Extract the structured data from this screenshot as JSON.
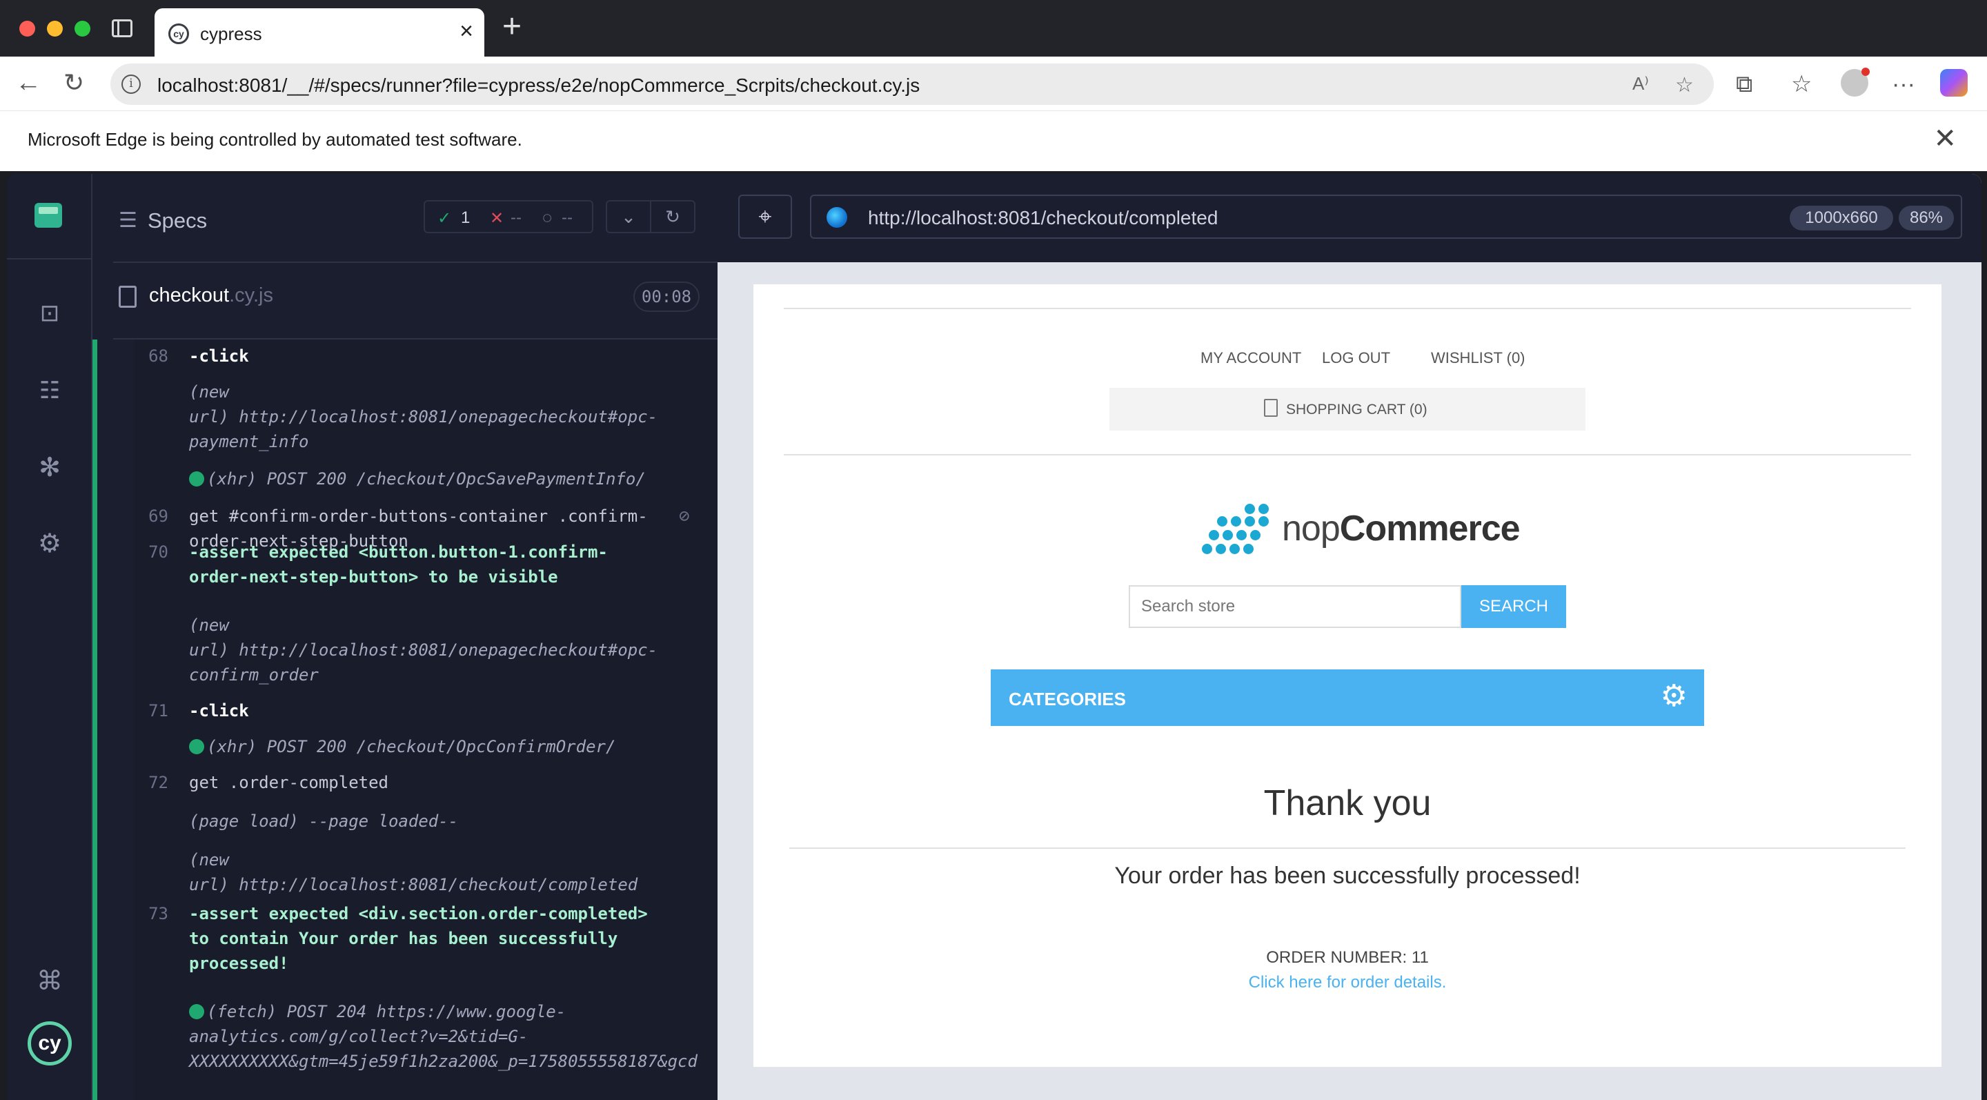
{
  "browser": {
    "tab_title": "cypress",
    "tab_favicon": "cy",
    "address": "localhost:8081/__/#/specs/runner?file=cypress/e2e/nopCommerce_Scrpits/checkout.cy.js",
    "info_bar": "Microsoft Edge is being controlled by automated test software."
  },
  "cypress": {
    "nav_logo_text": "cy",
    "reporter": {
      "specs_label": "Specs",
      "passed": "1",
      "failed": "--",
      "pending": "--",
      "spec_name": "checkout",
      "spec_ext": ".cy.js",
      "duration": "00:08"
    },
    "log": [
      {
        "num": "68",
        "lines": [
          "-click"
        ]
      },
      {
        "num": "",
        "lines": [
          "(new",
          "url)  http://localhost:8081/onepagecheckout#opc-",
          "payment_info"
        ]
      },
      {
        "num": "",
        "lines": [
          "(xhr)  POST 200 /checkout/OpcSavePaymentInfo/"
        ]
      },
      {
        "num": "69",
        "lines": [
          "get  #confirm-order-buttons-container .confirm-",
          "order-next-step-button"
        ]
      },
      {
        "num": "70",
        "lines": [
          "-assert  expected  <button.button-1.confirm-",
          "order-next-step-button>  to be  visible"
        ]
      },
      {
        "num": "",
        "lines": [
          "(new",
          "url)  http://localhost:8081/onepagecheckout#opc-",
          "confirm_order"
        ]
      },
      {
        "num": "71",
        "lines": [
          "-click"
        ]
      },
      {
        "num": "",
        "lines": [
          "(xhr)  POST 200 /checkout/OpcConfirmOrder/"
        ]
      },
      {
        "num": "72",
        "lines": [
          "get  .order-completed"
        ]
      },
      {
        "num": "",
        "lines": [
          "(page load)  --page loaded--"
        ]
      },
      {
        "num": "",
        "lines": [
          "(new",
          "url)  http://localhost:8081/checkout/completed"
        ]
      },
      {
        "num": "73",
        "lines": [
          "-assert  expected  <div.section.order-completed>",
          "to contain  Your order has been successfully",
          "processed!"
        ]
      },
      {
        "num": "",
        "lines": [
          "(fetch)  POST 204 https://www.google-",
          "analytics.com/g/collect?v=2&tid=G-",
          "XXXXXXXXXX&gtm=45je59f1h2za200&_p=1758055558187&gcd"
        ]
      }
    ],
    "aut": {
      "url": "http://localhost:8081/checkout/completed",
      "viewport": "1000x660",
      "zoom": "86%"
    }
  },
  "store": {
    "header_links": [
      "MY ACCOUNT",
      "LOG OUT",
      "WISHLIST (0)"
    ],
    "cart": "SHOPPING CART (0)",
    "logo_prefix": "nop",
    "logo_suffix": "Commerce",
    "search_placeholder": "Search store",
    "search_button": "SEARCH",
    "categories": "CATEGORIES",
    "title": "Thank you",
    "message": "Your order has been successfully processed!",
    "order_number": "ORDER NUMBER: 11",
    "order_link": "Click here for order details."
  },
  "colors": {
    "cypress_bg": "#1b1e2e",
    "pass_green": "#1fa971",
    "store_accent": "#4ab2f1"
  },
  "icons": [
    "search-icon",
    "gear-icon",
    "close-icon",
    "back-icon",
    "reload-icon",
    "star-icon",
    "crosshair-icon",
    "cart-icon",
    "command-icon",
    "bug-icon",
    "list-icon"
  ]
}
